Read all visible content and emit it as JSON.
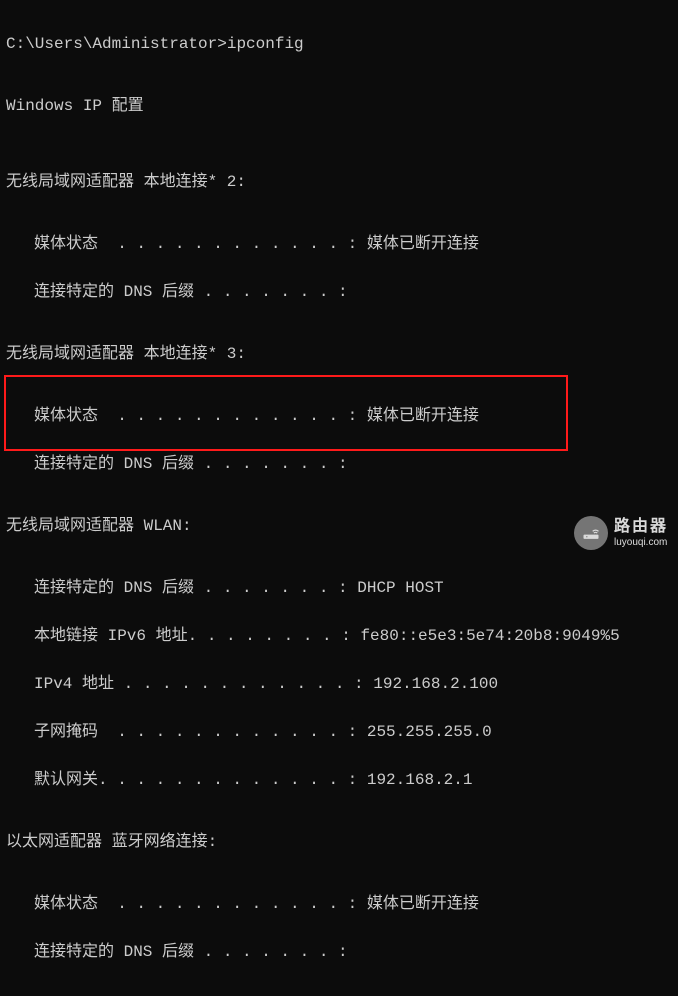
{
  "prompt_path": "C:\\Users\\Administrator>",
  "command": "ipconfig",
  "header": "Windows IP 配置",
  "adapters": [
    {
      "title": "无线局域网适配器 本地连接* 2:",
      "fields": [
        {
          "label": "媒体状态  . . . . . . . . . . . . :",
          "value": " 媒体已断开连接"
        },
        {
          "label": "连接特定的 DNS 后缀 . . . . . . . :",
          "value": ""
        }
      ]
    },
    {
      "title": "无线局域网适配器 本地连接* 3:",
      "fields": [
        {
          "label": "媒体状态  . . . . . . . . . . . . :",
          "value": " 媒体已断开连接"
        },
        {
          "label": "连接特定的 DNS 后缀 . . . . . . . :",
          "value": ""
        }
      ]
    },
    {
      "title": "无线局域网适配器 WLAN:",
      "fields": [
        {
          "label": "连接特定的 DNS 后缀 . . . . . . . :",
          "value": " DHCP HOST"
        },
        {
          "label": "本地链接 IPv6 地址. . . . . . . . :",
          "value": " fe80::e5e3:5e74:20b8:9049%5"
        },
        {
          "label": "IPv4 地址 . . . . . . . . . . . . :",
          "value": " 192.168.2.100"
        },
        {
          "label": "子网掩码  . . . . . . . . . . . . :",
          "value": " 255.255.255.0"
        },
        {
          "label": "默认网关. . . . . . . . . . . . . :",
          "value": " 192.168.2.1"
        }
      ]
    },
    {
      "title": "以太网适配器 蓝牙网络连接:",
      "fields": [
        {
          "label": "媒体状态  . . . . . . . . . . . . :",
          "value": " 媒体已断开连接"
        },
        {
          "label": "连接特定的 DNS 后缀 . . . . . . . :",
          "value": ""
        }
      ]
    }
  ],
  "highlight": {
    "adapter_index": 2,
    "field_start": 2,
    "field_end": 4
  },
  "watermark": {
    "cn": "路由器",
    "en": "luyouqi.com"
  }
}
